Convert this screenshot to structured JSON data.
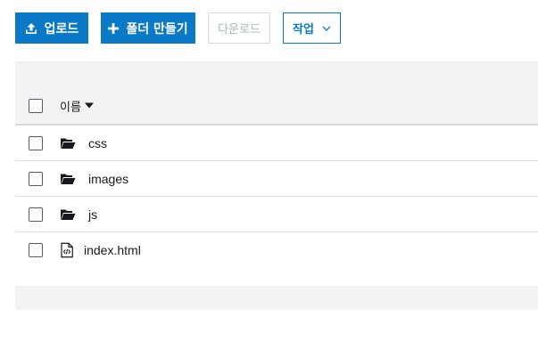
{
  "toolbar": {
    "upload_label": "업로드",
    "new_folder_label": "폴더 만들기",
    "download_label": "다운로드",
    "actions_label": "작업"
  },
  "table": {
    "name_header": "이름",
    "rows": [
      {
        "name": "css",
        "type": "folder",
        "icon": "folder-open-icon"
      },
      {
        "name": "images",
        "type": "folder",
        "icon": "folder-open-icon"
      },
      {
        "name": "js",
        "type": "folder",
        "icon": "folder-open-icon"
      },
      {
        "name": "index.html",
        "type": "file",
        "icon": "code-file-icon"
      }
    ]
  },
  "colors": {
    "primary": "#0a79c8",
    "disabled_text": "#aab7b8",
    "band": "#f2f3f3",
    "text": "#16191f"
  }
}
